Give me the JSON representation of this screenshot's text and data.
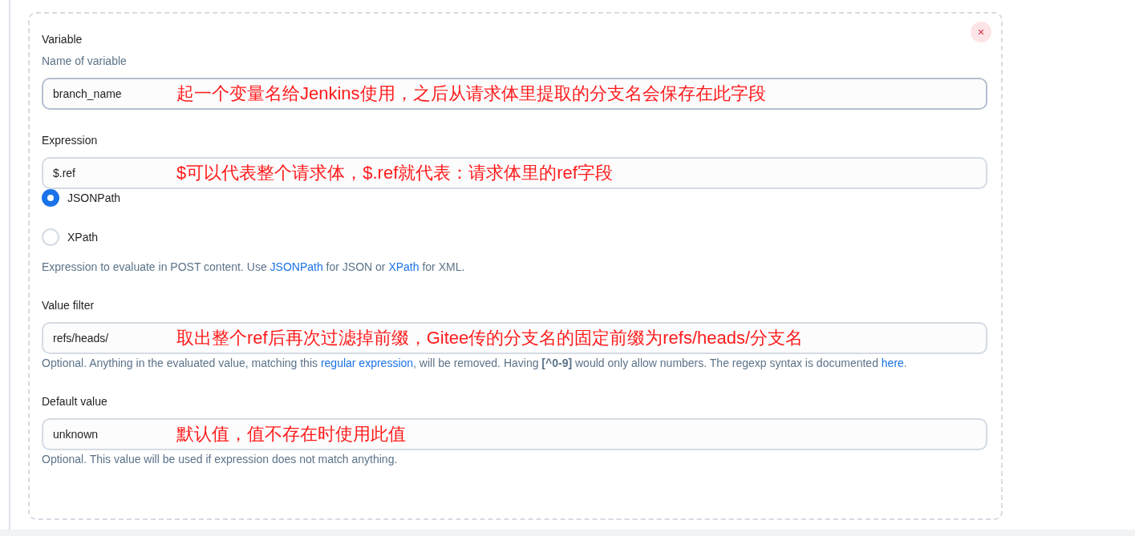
{
  "close_button": {
    "label": "×"
  },
  "fields": [
    {
      "label": "Variable",
      "description": "Name of variable",
      "value": "branch_name",
      "annotation": "起一个变量名给Jenkins使用，之后从请求体里提取的分支名会保存在此字段"
    },
    {
      "label": "Expression",
      "value": "$.ref",
      "annotation": "$可以代表整个请求体，$.ref就代表：请求体里的ref字段",
      "options": [
        {
          "label": "JSONPath",
          "selected": true
        },
        {
          "label": "XPath",
          "selected": false
        }
      ],
      "help": [
        {
          "kind": "text",
          "text": "Expression to evaluate in POST content. Use "
        },
        {
          "kind": "link",
          "text": "JSONPath"
        },
        {
          "kind": "text",
          "text": " for JSON or "
        },
        {
          "kind": "link",
          "text": "XPath"
        },
        {
          "kind": "text",
          "text": " for XML."
        }
      ]
    },
    {
      "label": "Value filter",
      "value": "refs/heads/",
      "annotation": "取出整个ref后再次过滤掉前缀，Gitee传的分支名的固定前缀为refs/heads/分支名",
      "help": [
        {
          "kind": "text",
          "text": "Optional. Anything in the evaluated value, matching this "
        },
        {
          "kind": "link",
          "text": "regular expression"
        },
        {
          "kind": "text",
          "text": ", will be removed. Having "
        },
        {
          "kind": "bold",
          "text": "[^0-9]"
        },
        {
          "kind": "text",
          "text": " would only allow numbers. The regexp syntax is documented "
        },
        {
          "kind": "link",
          "text": "here"
        },
        {
          "kind": "text",
          "text": "."
        }
      ]
    },
    {
      "label": "Default value",
      "value": "unknown",
      "annotation": "默认值，值不存在时使用此值",
      "help": [
        {
          "kind": "text",
          "text": "Optional. This value will be used if expression does not match anything."
        }
      ]
    }
  ]
}
